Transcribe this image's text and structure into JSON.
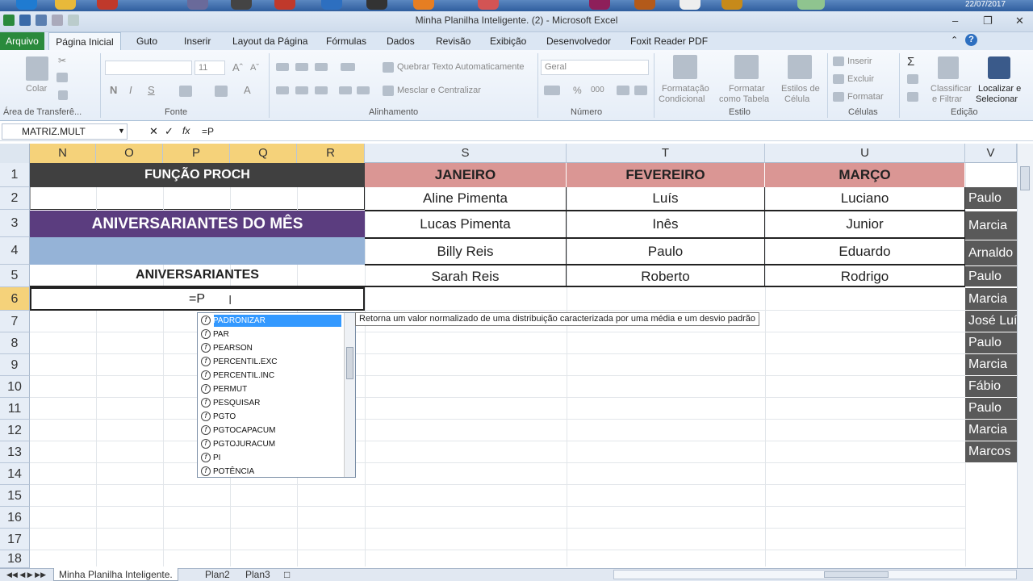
{
  "window": {
    "title": "Minha Planilha Inteligente. (2)  -  Microsoft Excel",
    "date": "22/07/2017"
  },
  "tabs": [
    "Arquivo",
    "Página Inicial",
    "Guto",
    "Inserir",
    "Layout da Página",
    "Fórmulas",
    "Dados",
    "Revisão",
    "Exibição",
    "Desenvolvedor",
    "Foxit Reader PDF"
  ],
  "ribbon": {
    "colar": "Colar",
    "area_transferencia": "Área de Transferê...",
    "fonte": "Fonte",
    "font_size": "11",
    "alinhamento": "Alinhamento",
    "quebrar": "Quebrar Texto Automaticamente",
    "mesclar": "Mesclar e Centralizar",
    "numero": "Número",
    "number_format": "Geral",
    "estilo": "Estilo",
    "formatacao": "Formatação",
    "condicional": "Condicional",
    "formatar": "Formatar",
    "como_tabela": "como Tabela",
    "estilos_de": "Estilos de",
    "celula": "Célula",
    "celulas": "Células",
    "inserir": "Inserir",
    "excluir": "Excluir",
    "formatar_cel": "Formatar",
    "edicao": "Edição",
    "classificar": "Classificar",
    "e_filtrar": "e Filtrar",
    "localizar": "Localizar e",
    "selecionar": "Selecionar"
  },
  "formula_bar": {
    "name_box": "MATRIZ.MULT",
    "content": "=P"
  },
  "columns": [
    "N",
    "O",
    "P",
    "Q",
    "R",
    "S",
    "T",
    "U",
    "V"
  ],
  "rows": [
    "1",
    "2",
    "3",
    "4",
    "5",
    "6",
    "7",
    "8",
    "9",
    "10",
    "11",
    "12",
    "13",
    "14",
    "15",
    "16",
    "17",
    "18"
  ],
  "cells": {
    "funcao": "FUNÇÃO PROCH",
    "aniversariantes_mes": "ANIVERSARIANTES DO MÊS",
    "aniversariantes": "ANIVERSARIANTES",
    "editing": "=P",
    "months": [
      "JANEIRO",
      "FEVEREIRO",
      "MARÇO"
    ],
    "jan": [
      "Aline Pimenta",
      "Lucas Pimenta",
      "Billy Reis",
      "Sarah Reis"
    ],
    "fev": [
      "Luís",
      "Inês",
      "Paulo",
      "Roberto"
    ],
    "mar": [
      "Luciano",
      "Junior",
      "Eduardo",
      "Rodrigo"
    ],
    "col_v": [
      "Paulo",
      "Marcia",
      "Arnaldo",
      "Paulo",
      "Marcia",
      "José Luís",
      "Paulo",
      "Marcia",
      "Fábio",
      "Paulo",
      "Marcia",
      "Marcos"
    ]
  },
  "autocomplete": [
    "PADRONIZAR",
    "PAR",
    "PEARSON",
    "PERCENTIL.EXC",
    "PERCENTIL.INC",
    "PERMUT",
    "PESQUISAR",
    "PGTO",
    "PGTOCAPACUM",
    "PGTOJURACUM",
    "PI",
    "POTÊNCIA"
  ],
  "tooltip": "Retorna um valor normalizado de uma distribuição caracterizada por uma média e um desvio padrão",
  "sheets": [
    "Minha Planilha Inteligente.",
    "Plan2",
    "Plan3"
  ],
  "colors": {
    "header_dark": "#404040",
    "purple": "#5b3d7f",
    "light_blue": "#95b3d7",
    "month_red": "#da9694",
    "selected_col": "#f5d27a",
    "excel_green": "#2a8a3c"
  }
}
